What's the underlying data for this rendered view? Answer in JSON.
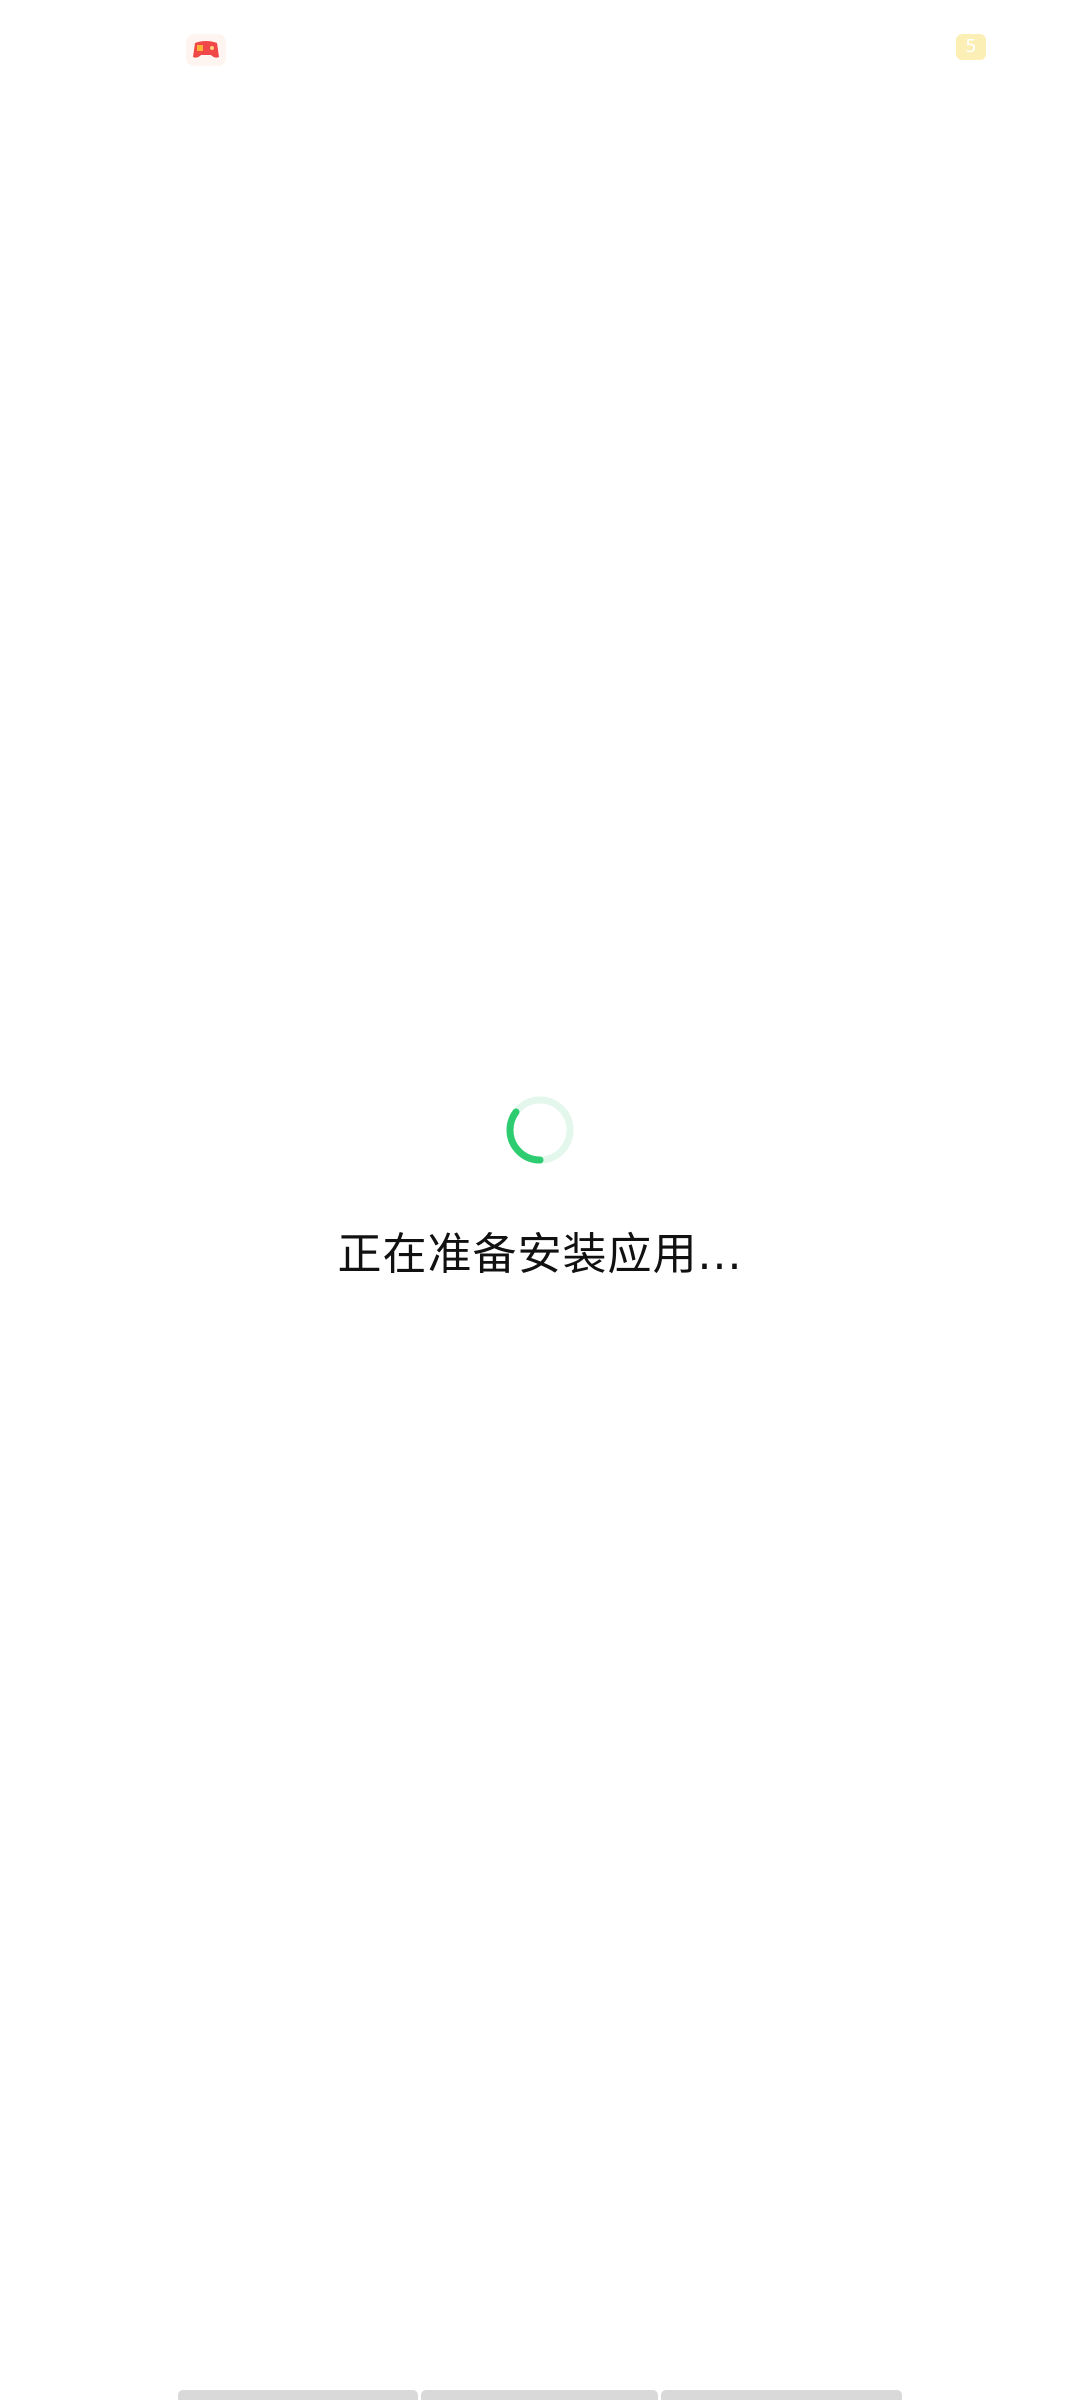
{
  "top_bar": {
    "left_icon": "game-app-icon",
    "right_icon": "yellow-app-icon"
  },
  "status": {
    "text": "正在准备安装应用...",
    "spinner_icon": "loading-spinner-icon",
    "spinner_color": "#2ecc71",
    "spinner_track_color": "#e3f7ec"
  },
  "bottom_tabs": {
    "count": 3
  }
}
